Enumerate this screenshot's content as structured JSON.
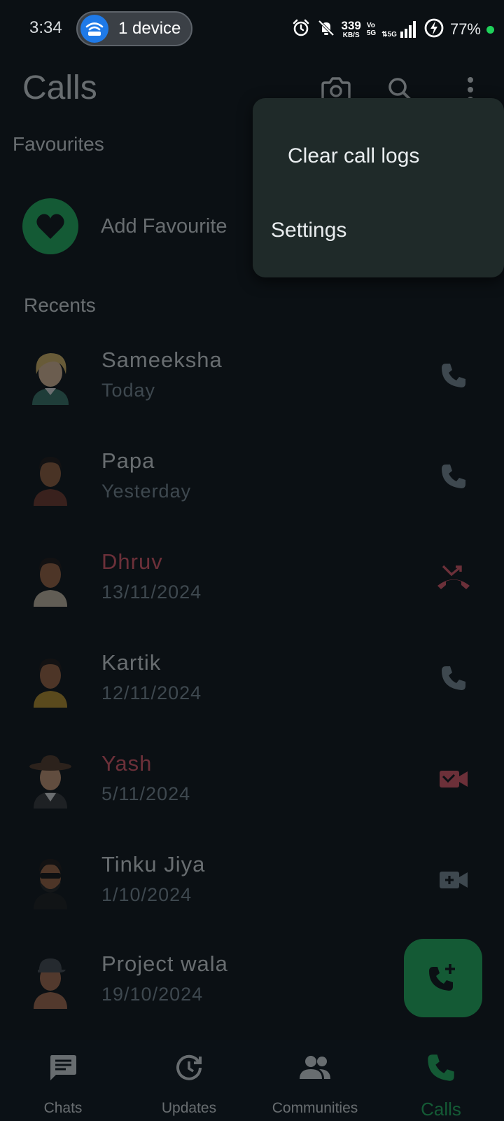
{
  "status_bar": {
    "time": "3:34",
    "hotspot_label": "1 device",
    "net_speed_value": "339",
    "net_speed_unit": "KB/S",
    "volte_top": "Vo",
    "volte_bottom": "5G",
    "network_type": "5G",
    "battery_percent": "77%"
  },
  "header": {
    "title": "Calls"
  },
  "favourites": {
    "section_label": "Favourites",
    "add_label": "Add Favourite"
  },
  "recents": {
    "section_label": "Recents",
    "items": [
      {
        "name": "Sameeksha",
        "date": "Today",
        "missed": false,
        "action_icon": "phone-icon"
      },
      {
        "name": "Papa",
        "date": "Yesterday",
        "missed": false,
        "action_icon": "phone-icon"
      },
      {
        "name": "Dhruv",
        "date": "13/11/2024",
        "missed": true,
        "action_icon": "missed-call-icon"
      },
      {
        "name": "Kartik",
        "date": "12/11/2024",
        "missed": false,
        "action_icon": "phone-icon"
      },
      {
        "name": "Yash",
        "date": "5/11/2024",
        "missed": true,
        "action_icon": "missed-video-call-icon"
      },
      {
        "name": "Tinku Jiya",
        "date": "1/10/2024",
        "missed": false,
        "action_icon": "video-call-icon"
      },
      {
        "name": "Project wala",
        "date": "19/10/2024",
        "missed": false,
        "action_icon": "phone-icon"
      }
    ]
  },
  "menu": {
    "items": [
      {
        "label": "Clear call logs"
      },
      {
        "label": "Settings"
      }
    ]
  },
  "bottom_nav": {
    "items": [
      {
        "label": "Chats",
        "icon": "chat-icon",
        "active": false
      },
      {
        "label": "Updates",
        "icon": "updates-icon",
        "active": false
      },
      {
        "label": "Communities",
        "icon": "communities-icon",
        "active": false
      },
      {
        "label": "Calls",
        "icon": "phone-icon",
        "active": true
      }
    ]
  },
  "colors": {
    "accent": "#21c063",
    "missed": "#f15c6d",
    "background": "#0b1014",
    "menu_background": "#1f2a29"
  }
}
